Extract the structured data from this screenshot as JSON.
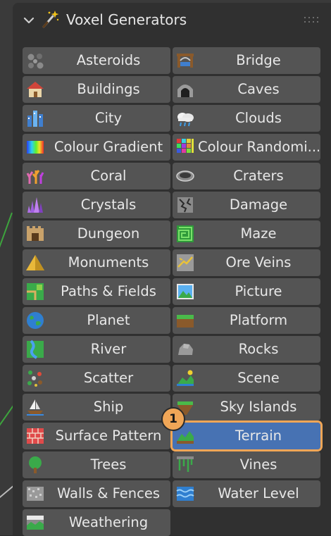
{
  "panel": {
    "title": "Voxel Generators",
    "accent": "#4772b3",
    "highlight": "#f0a657"
  },
  "badge": {
    "number": "1"
  },
  "generators": [
    {
      "label": "Asteroids",
      "icon": "asteroids-icon"
    },
    {
      "label": "Bridge",
      "icon": "bridge-icon"
    },
    {
      "label": "Buildings",
      "icon": "house-icon"
    },
    {
      "label": "Caves",
      "icon": "cave-icon"
    },
    {
      "label": "City",
      "icon": "city-icon"
    },
    {
      "label": "Clouds",
      "icon": "cloud-icon"
    },
    {
      "label": "Colour Gradient",
      "icon": "gradient-icon"
    },
    {
      "label": "Colour Randomi...",
      "icon": "random-colour-icon"
    },
    {
      "label": "Coral",
      "icon": "coral-icon"
    },
    {
      "label": "Craters",
      "icon": "crater-icon"
    },
    {
      "label": "Crystals",
      "icon": "crystal-icon"
    },
    {
      "label": "Damage",
      "icon": "damage-icon"
    },
    {
      "label": "Dungeon",
      "icon": "dungeon-icon"
    },
    {
      "label": "Maze",
      "icon": "maze-icon"
    },
    {
      "label": "Monuments",
      "icon": "pyramid-icon"
    },
    {
      "label": "Ore Veins",
      "icon": "ore-icon"
    },
    {
      "label": "Paths & Fields",
      "icon": "fields-icon"
    },
    {
      "label": "Picture",
      "icon": "picture-icon"
    },
    {
      "label": "Planet",
      "icon": "planet-icon"
    },
    {
      "label": "Platform",
      "icon": "platform-icon"
    },
    {
      "label": "River",
      "icon": "river-icon"
    },
    {
      "label": "Rocks",
      "icon": "rock-icon"
    },
    {
      "label": "Scatter",
      "icon": "scatter-icon"
    },
    {
      "label": "Scene",
      "icon": "scene-icon"
    },
    {
      "label": "Ship",
      "icon": "ship-icon"
    },
    {
      "label": "Sky Islands",
      "icon": "sky-island-icon"
    },
    {
      "label": "Surface Pattern",
      "icon": "brick-icon"
    },
    {
      "label": "Terrain",
      "icon": "terrain-icon",
      "selected": true
    },
    {
      "label": "Trees",
      "icon": "tree-icon"
    },
    {
      "label": "Vines",
      "icon": "vines-icon"
    },
    {
      "label": "Walls & Fences",
      "icon": "wall-icon"
    },
    {
      "label": "Water Level",
      "icon": "water-icon"
    },
    {
      "label": "Weathering",
      "icon": "weathering-icon"
    }
  ]
}
